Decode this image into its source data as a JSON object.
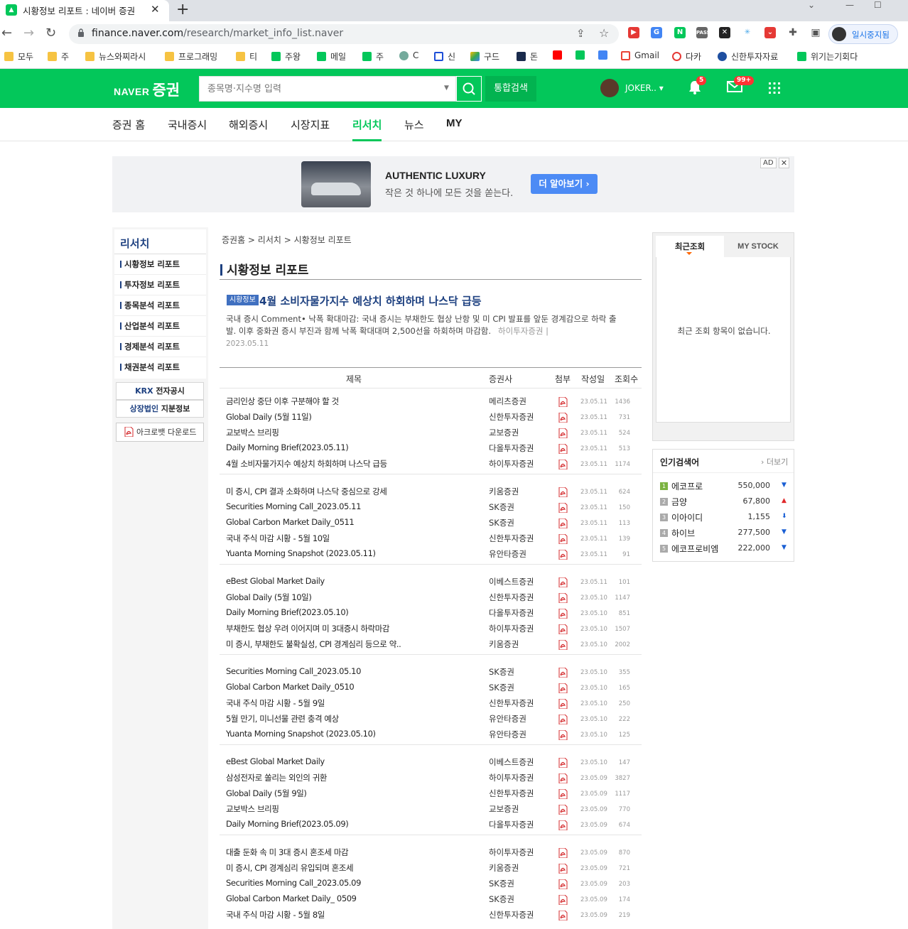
{
  "browser": {
    "tab_title": "시황정보 리포트 : 네이버 증권",
    "url_host": "finance.naver.com",
    "url_path": "/research/market_info_list.naver",
    "profile_label": "일시중지됨",
    "bookmarks": [
      "모두",
      "주",
      "뉴스와찌라시",
      "프로그래밍",
      "티",
      "주왕",
      "메일",
      "주",
      "C",
      "신",
      "구드",
      "돈",
      "Gmail",
      "다카",
      "신한투자자료",
      "위기는기회다"
    ]
  },
  "header": {
    "logo_naver": "NAVER",
    "logo_service": "증권",
    "search_placeholder": "종목명·지수명 입력",
    "total_search_label": "통합검색",
    "user_name": "JOKER..",
    "notif_count": "5",
    "mail_count": "99+"
  },
  "gnb": {
    "items": [
      "증권 홈",
      "국내증시",
      "해외증시",
      "시장지표",
      "리서치",
      "뉴스",
      "MY"
    ],
    "active": "리서치"
  },
  "ad": {
    "title": "AUTHENTIC LUXURY",
    "subtitle": "작은 것 하나에 모든 것을 쏟는다.",
    "button": "더 알아보기 ›",
    "tag": "AD",
    "close": "✕"
  },
  "lnb": {
    "title": "리서치",
    "items": [
      "시황정보 리포트",
      "투자정보 리포트",
      "종목분석 리포트",
      "산업분석 리포트",
      "경제분석 리포트",
      "채권분석 리포트"
    ],
    "krx_a": "KRX",
    "krx_b": " 전자공시",
    "listed_a": "상장법인",
    "listed_b": " 지분정보",
    "acrobat": "아크로뱃 다운로드"
  },
  "main": {
    "breadcrumb": "증권홈 > 리서치 > 시황정보 리포트",
    "page_title": "시황정보 리포트",
    "featured": {
      "tag": "시황정보",
      "title": "4월 소비자물가지수 예상치 하회하며 나스닥 급등",
      "body": "국내 증시 Comment• 낙폭 확대마감: 국내 증시는 부채한도 협상 난항 및 미 CPI 발표를 앞둔 경계감으로 하락 출발. 이후 중화권 증시 부진과 함께 낙폭 확대대며 2,500선을 하회하며 마감함.",
      "source": "하이투자증권 |",
      "date": "2023.05.11"
    },
    "columns": [
      "제목",
      "증권사",
      "첨부",
      "작성일",
      "조회수"
    ],
    "rows": [
      {
        "title": "금리인상 중단 이후 구분해야 할 것",
        "broker": "메리츠증권",
        "date": "23.05.11",
        "views": "1436"
      },
      {
        "title": "Global Daily (5월 11일)",
        "broker": "신한투자증권",
        "date": "23.05.11",
        "views": "731"
      },
      {
        "title": "교보박스 브리핑",
        "broker": "교보증권",
        "date": "23.05.11",
        "views": "524"
      },
      {
        "title": "Daily Morning Brief(2023.05.11)",
        "broker": "다올투자증권",
        "date": "23.05.11",
        "views": "513"
      },
      {
        "title": "4월 소비자물가지수 예상치 하회하며 나스닥 급등",
        "broker": "하이투자증권",
        "date": "23.05.11",
        "views": "1174"
      },
      {
        "title": "미 증시, CPI 결과 소화하며 나스닥 중심으로 강세",
        "broker": "키움증권",
        "date": "23.05.11",
        "views": "624"
      },
      {
        "title": "Securities Morning Call_2023.05.11",
        "broker": "SK증권",
        "date": "23.05.11",
        "views": "150"
      },
      {
        "title": "Global Carbon Market Daily_0511",
        "broker": "SK증권",
        "date": "23.05.11",
        "views": "113"
      },
      {
        "title": "국내 주식 마감 시황 - 5월 10일",
        "broker": "신한투자증권",
        "date": "23.05.11",
        "views": "139"
      },
      {
        "title": "Yuanta Morning Snapshot (2023.05.11)",
        "broker": "유안타증권",
        "date": "23.05.11",
        "views": "91"
      },
      {
        "title": "eBest Global Market Daily",
        "broker": "이베스트증권",
        "date": "23.05.11",
        "views": "101"
      },
      {
        "title": "Global Daily (5월 10일)",
        "broker": "신한투자증권",
        "date": "23.05.10",
        "views": "1147"
      },
      {
        "title": "Daily Morning Brief(2023.05.10)",
        "broker": "다올투자증권",
        "date": "23.05.10",
        "views": "851"
      },
      {
        "title": "부채한도 협상 우려 이어지며 미 3대증시 하락마감",
        "broker": "하이투자증권",
        "date": "23.05.10",
        "views": "1507"
      },
      {
        "title": "미 증시, 부채한도 불확실성, CPI 경계심리 등으로 약..",
        "broker": "키움증권",
        "date": "23.05.10",
        "views": "2002"
      },
      {
        "title": "Securities Morning Call_2023.05.10",
        "broker": "SK증권",
        "date": "23.05.10",
        "views": "355"
      },
      {
        "title": "Global Carbon Market Daily_0510",
        "broker": "SK증권",
        "date": "23.05.10",
        "views": "165"
      },
      {
        "title": "국내 주식 마감 시황 - 5월 9일",
        "broker": "신한투자증권",
        "date": "23.05.10",
        "views": "250"
      },
      {
        "title": "5월 만기, 미니선물 관련 충격 예상",
        "broker": "유안타증권",
        "date": "23.05.10",
        "views": "222"
      },
      {
        "title": "Yuanta Morning Snapshot (2023.05.10)",
        "broker": "유안타증권",
        "date": "23.05.10",
        "views": "125"
      },
      {
        "title": "eBest Global Market Daily",
        "broker": "이베스트증권",
        "date": "23.05.10",
        "views": "147"
      },
      {
        "title": "삼성전자로 쏠리는 외인의 귀환",
        "broker": "하이투자증권",
        "date": "23.05.09",
        "views": "3827"
      },
      {
        "title": "Global Daily (5월 9일)",
        "broker": "신한투자증권",
        "date": "23.05.09",
        "views": "1117"
      },
      {
        "title": "교보박스 브리핑",
        "broker": "교보증권",
        "date": "23.05.09",
        "views": "770"
      },
      {
        "title": "Daily Morning Brief(2023.05.09)",
        "broker": "다올투자증권",
        "date": "23.05.09",
        "views": "674"
      },
      {
        "title": "대출 둔화 속 미 3대 증시 혼조세 마감",
        "broker": "하이투자증권",
        "date": "23.05.09",
        "views": "870"
      },
      {
        "title": "미 증시, CPI 경계심리 유입되며 혼조세",
        "broker": "키움증권",
        "date": "23.05.09",
        "views": "721"
      },
      {
        "title": "Securities Morning Call_2023.05.09",
        "broker": "SK증권",
        "date": "23.05.09",
        "views": "203"
      },
      {
        "title": "Global Carbon Market Daily_ 0509",
        "broker": "SK증권",
        "date": "23.05.09",
        "views": "174"
      },
      {
        "title": "국내 주식 마감 시황 - 5월 8일",
        "broker": "신한투자증권",
        "date": "23.05.09",
        "views": "219"
      }
    ]
  },
  "side": {
    "recent_tab": "최근조회",
    "mystock_tab": "MY STOCK",
    "empty_msg": "최근 조회 항목이 없습니다.",
    "popular_title": "인기검색어",
    "popular_more": "› 더보기",
    "popular": [
      {
        "rank": "1",
        "name": "에코프로",
        "price": "550,000",
        "dir": "down",
        "dir_symbol": "▼",
        "color": "#1a5fd4"
      },
      {
        "rank": "2",
        "name": "금양",
        "price": "67,800",
        "dir": "up",
        "dir_symbol": "▲",
        "color": "#e0292b"
      },
      {
        "rank": "3",
        "name": "이아이디",
        "price": "1,155",
        "dir": "lower-limit",
        "dir_symbol": "⬇",
        "color": "#1a5fd4"
      },
      {
        "rank": "4",
        "name": "하이브",
        "price": "277,500",
        "dir": "down",
        "dir_symbol": "▼",
        "color": "#1a5fd4"
      },
      {
        "rank": "5",
        "name": "에코프로비엠",
        "price": "222,000",
        "dir": "down",
        "dir_symbol": "▼",
        "color": "#1a5fd4"
      }
    ]
  },
  "colors": {
    "naver_green": "#03c75a",
    "navy": "#1d4080",
    "pdf_red": "#d4282b"
  }
}
